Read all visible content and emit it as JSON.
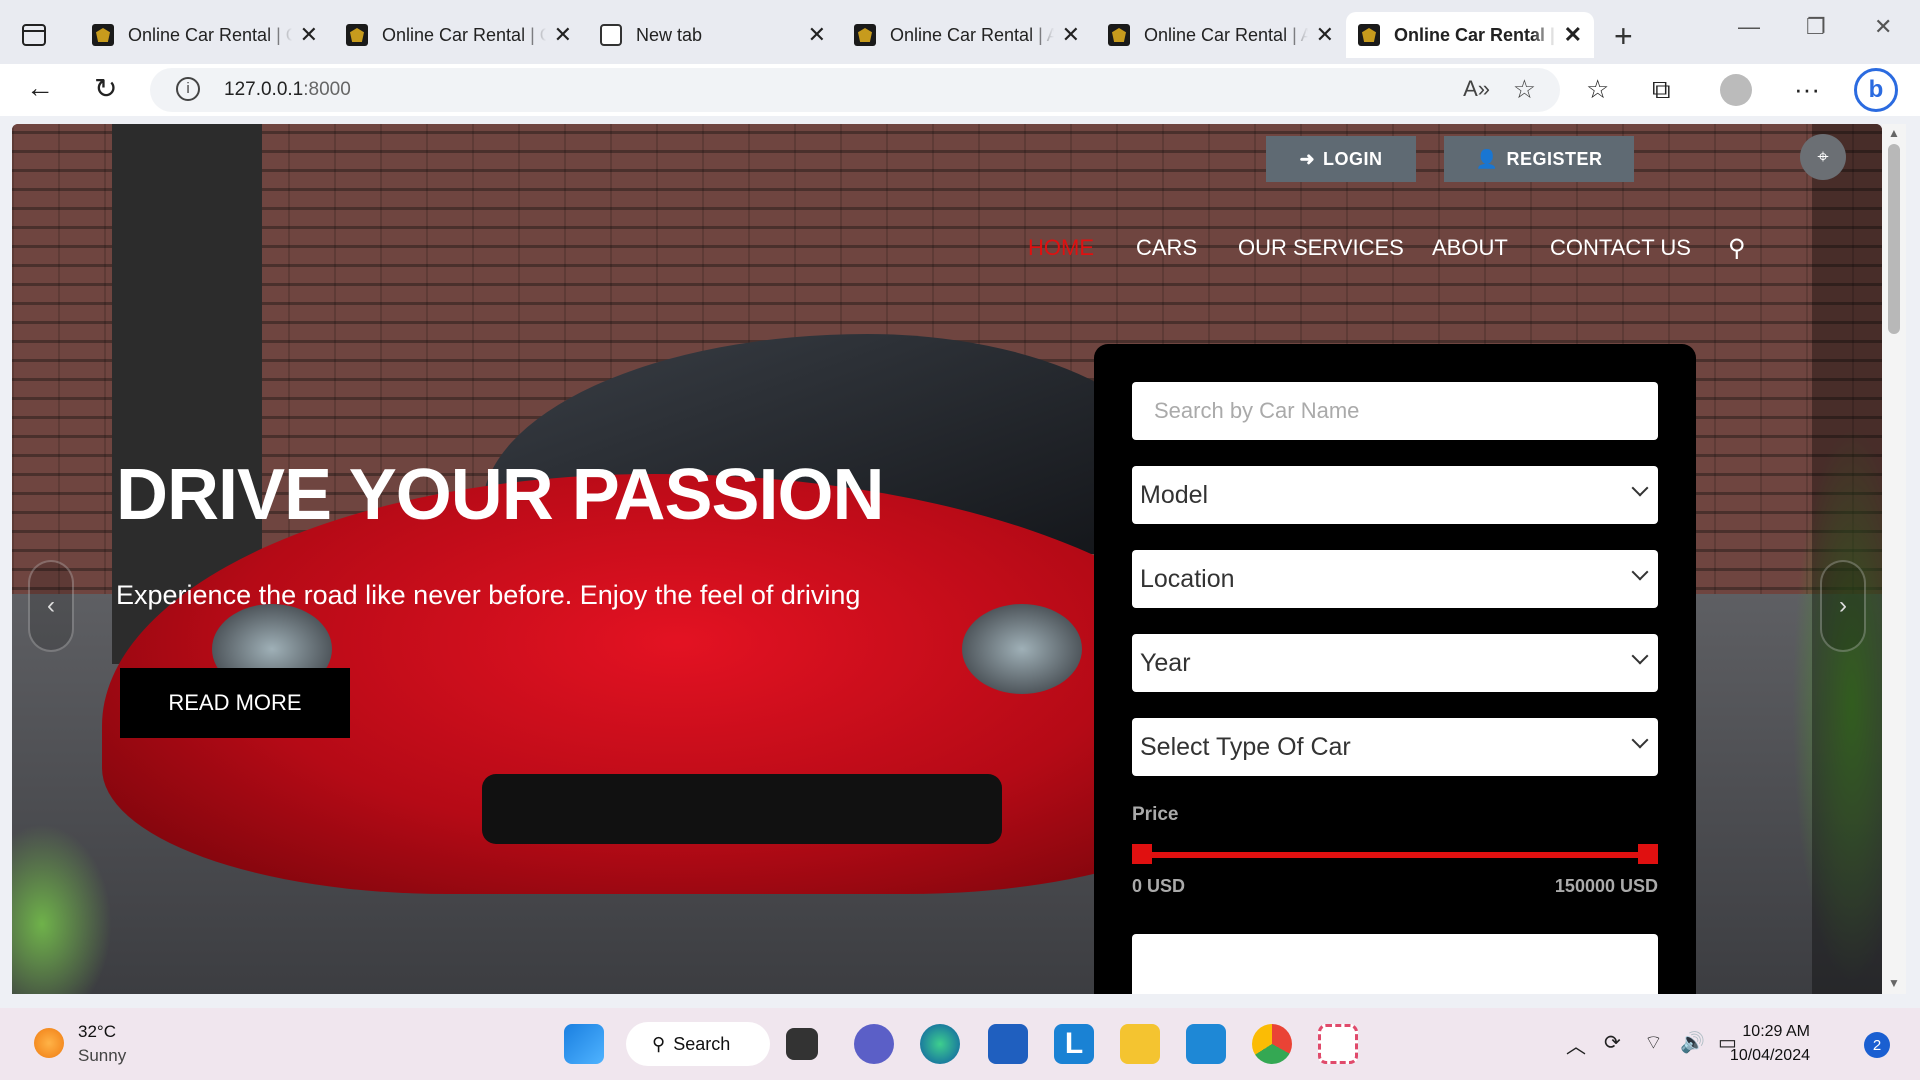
{
  "browser": {
    "tabs": [
      {
        "title": "Online Car Rental | Car Details",
        "active": false
      },
      {
        "title": "Online Car Rental | Car Details",
        "active": false
      },
      {
        "title": "New tab",
        "active": false
      },
      {
        "title": "Online Car Rental | About",
        "active": false
      },
      {
        "title": "Online Car Rental | About",
        "active": false
      },
      {
        "title": "Online Car Rental | Home",
        "active": true
      }
    ],
    "url_host": "127.0.0.1",
    "url_port": ":8000"
  },
  "site": {
    "login_label": "LOGIN",
    "register_label": "REGISTER",
    "menu": [
      "HOME",
      "CARS",
      "OUR SERVICES",
      "ABOUT",
      "CONTACT US"
    ],
    "active_menu": "HOME",
    "accent_color": "#e01010",
    "hero": {
      "title": "DRIVE YOUR PASSION",
      "subtitle": "Experience the road like never before. Enjoy the feel of driving",
      "cta": "READ MORE"
    },
    "search": {
      "name_placeholder": "Search by Car Name",
      "model": "Model",
      "location": "Location",
      "year": "Year",
      "type": "Select Type Of Car",
      "price_label": "Price",
      "price_min": "0 USD",
      "price_max": "150000 USD",
      "price_range_fraction": [
        0.0,
        1.0
      ]
    }
  },
  "taskbar": {
    "temperature": "32°C",
    "condition": "Sunny",
    "search_label": "Search",
    "time": "10:29 AM",
    "date": "10/04/2024",
    "notifications": "2"
  }
}
